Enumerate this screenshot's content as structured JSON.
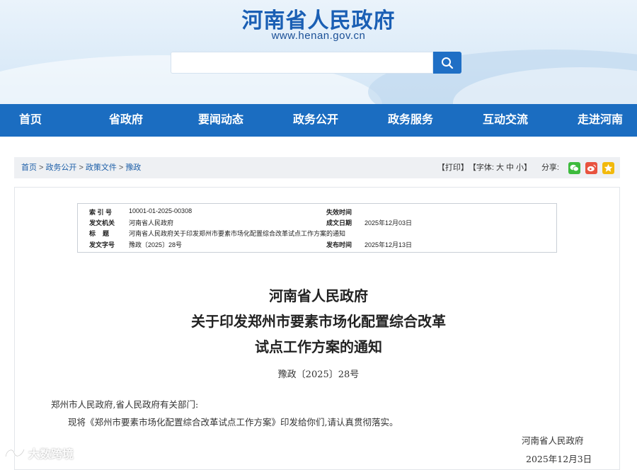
{
  "header": {
    "site_title": "河南省人民政府",
    "site_url": "www.henan.gov.cn",
    "search_placeholder": ""
  },
  "nav": {
    "items": [
      {
        "label": "首页"
      },
      {
        "label": "省政府"
      },
      {
        "label": "要闻动态"
      },
      {
        "label": "政务公开"
      },
      {
        "label": "政务服务"
      },
      {
        "label": "互动交流"
      },
      {
        "label": "走进河南"
      }
    ]
  },
  "breadcrumb": {
    "items": [
      "首页",
      "政务公开",
      "政策文件",
      "豫政"
    ],
    "separator": ">"
  },
  "tools": {
    "print": "【打印】",
    "font_label": "【字体:",
    "font_large": "大",
    "font_medium": "中",
    "font_small": "小",
    "font_close": "】",
    "share_label": "分享:",
    "icons": [
      "wechat-icon",
      "weibo-icon",
      "favorite-icon"
    ],
    "colors": {
      "wechat": "#3dbb3d",
      "weibo": "#e8533f",
      "favorite": "#f2b90c"
    }
  },
  "meta": {
    "index_label": "索 引 号",
    "index_value": "10001-01-2025-00308",
    "expire_label": "失效时间",
    "expire_value": "",
    "issuer_label": "发文机关",
    "issuer_value": "河南省人民政府",
    "made_label": "成文日期",
    "made_value": "2025年12月03日",
    "title_label": "标    题",
    "title_value": "河南省人民政府关于印发郑州市要素市场化配置综合改革试点工作方案的通知",
    "docno_label": "发文字号",
    "docno_value": "豫政〔2025〕28号",
    "publish_label": "发布时间",
    "publish_value": "2025年12月13日"
  },
  "document": {
    "title_lines": [
      "河南省人民政府",
      "关于印发郑州市要素市场化配置综合改革",
      "试点工作方案的通知"
    ],
    "doc_number": "豫政〔2025〕28号",
    "salutation": "郑州市人民政府,省人民政府有关部门:",
    "body": "现将《郑州市要素市场化配置综合改革试点工作方案》印发给你们,请认真贯彻落实。",
    "signature": "河南省人民政府",
    "date": "2025年12月3日"
  },
  "watermark": {
    "text": "大数跨境"
  },
  "theme": {
    "nav_blue": "#1b6dc1",
    "title_blue": "#1a5fb4"
  }
}
